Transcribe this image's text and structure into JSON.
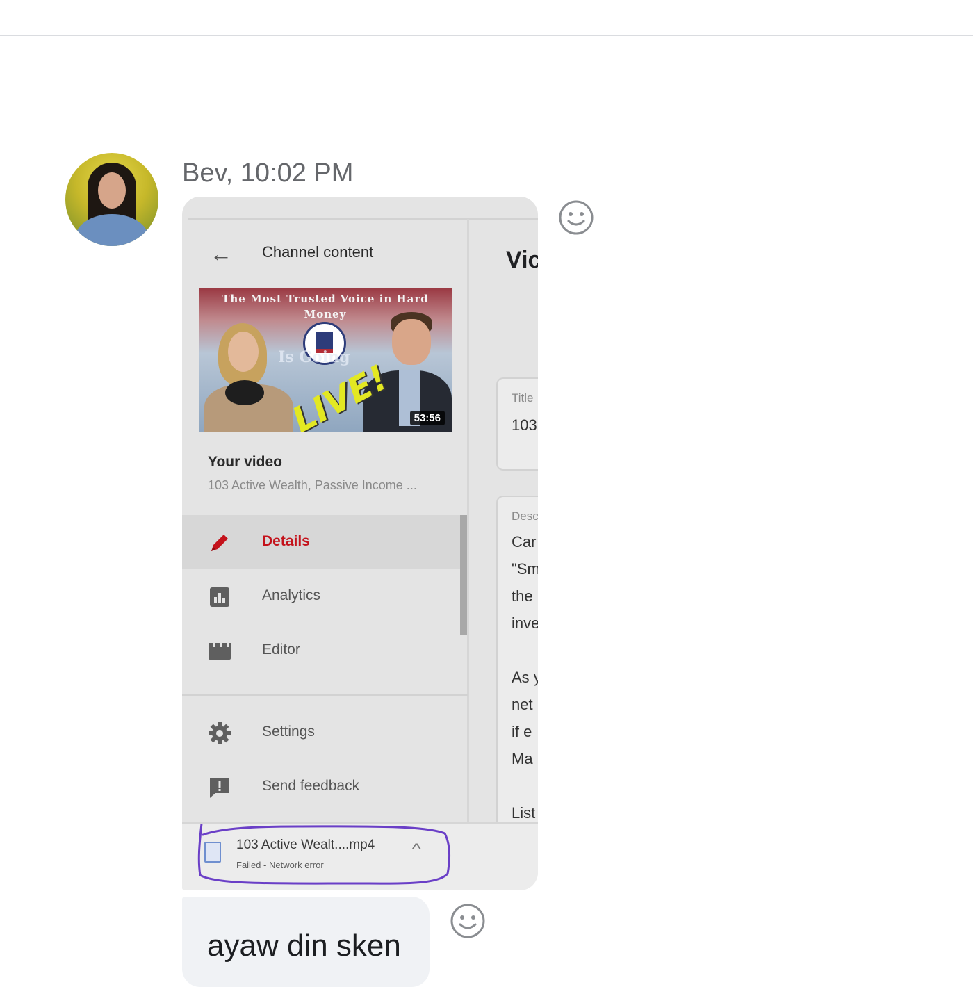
{
  "message": {
    "sender_time": "Bev, 10:02 PM",
    "text": "ayaw din sken"
  },
  "screenshot": {
    "header_title": "Channel content",
    "thumbnail": {
      "title_text": "The Most Trusted Voice in Hard Money",
      "overlay_text": "Is Going",
      "live_text": "LIVE!",
      "duration": "53:56"
    },
    "your_video_label": "Your video",
    "video_name": "103 Active Wealth, Passive Income ...",
    "nav": [
      {
        "label": "Details",
        "icon": "pencil-icon",
        "active": true
      },
      {
        "label": "Analytics",
        "icon": "analytics-icon",
        "active": false
      },
      {
        "label": "Editor",
        "icon": "clapperboard-icon",
        "active": false
      },
      {
        "label": "Settings",
        "icon": "gear-icon",
        "active": false
      },
      {
        "label": "Send feedback",
        "icon": "feedback-icon",
        "active": false
      }
    ],
    "right_panel": {
      "heading": "Vic",
      "title_field_label": "Title",
      "title_field_value": "103",
      "desc_field_label": "Desc",
      "desc_lines": [
        "Car",
        "\"Sm",
        "the",
        "inve",
        "",
        "As y",
        "net",
        "if e",
        "Ma",
        "",
        "List"
      ]
    },
    "download": {
      "file_name": "103 Active Wealt....mp4",
      "status": "Failed - Network error",
      "icon": "file-icon"
    }
  },
  "colors": {
    "active_nav": "#c4121b",
    "highlight_stroke": "#6a3fc7",
    "bubble_bg": "#f0f2f5"
  }
}
